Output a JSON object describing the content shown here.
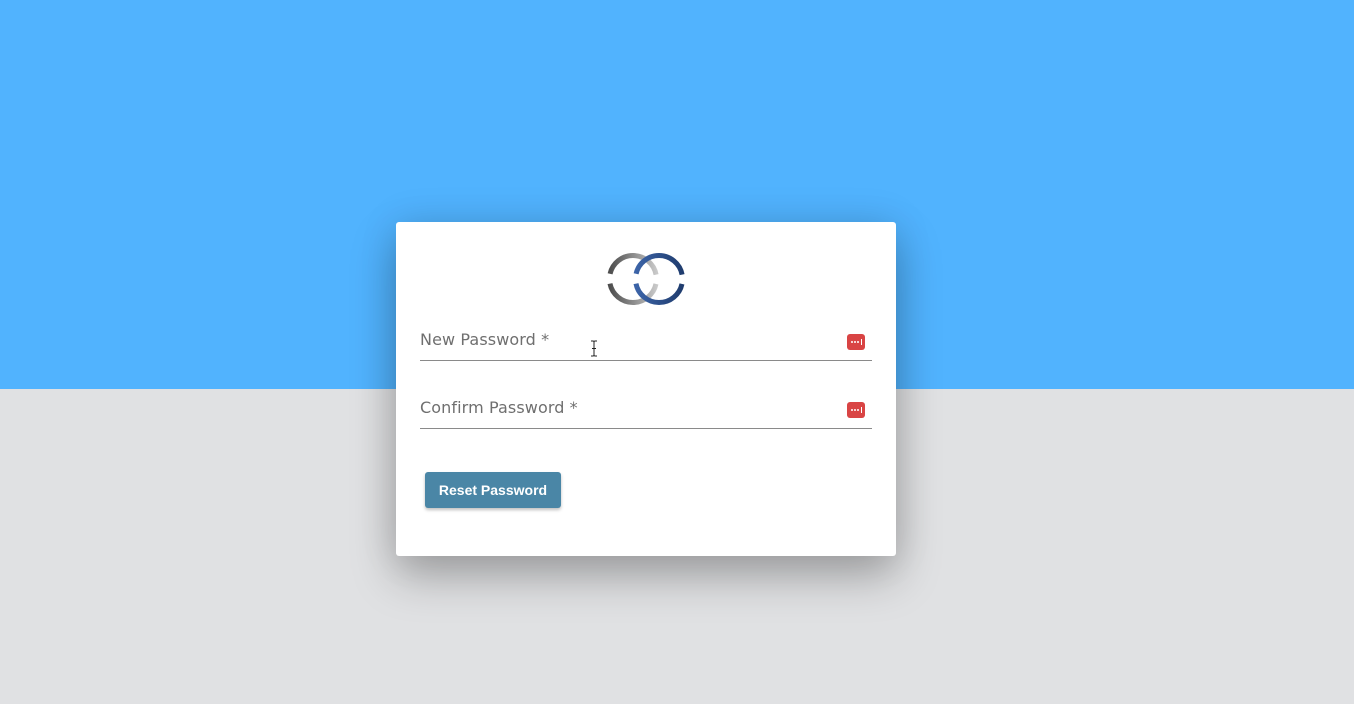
{
  "colors": {
    "top_background": "#51b3fe",
    "bottom_background": "#e0e1e3",
    "button": "#4a86a6",
    "password_icon": "#d94444"
  },
  "logo": {
    "icon": "interlocking-rings-logo-icon"
  },
  "form": {
    "new_password": {
      "label": "New Password *",
      "value": "",
      "icon": "password-manager-icon"
    },
    "confirm_password": {
      "label": "Confirm Password *",
      "value": "",
      "icon": "password-manager-icon"
    },
    "submit_label": "Reset Password"
  }
}
